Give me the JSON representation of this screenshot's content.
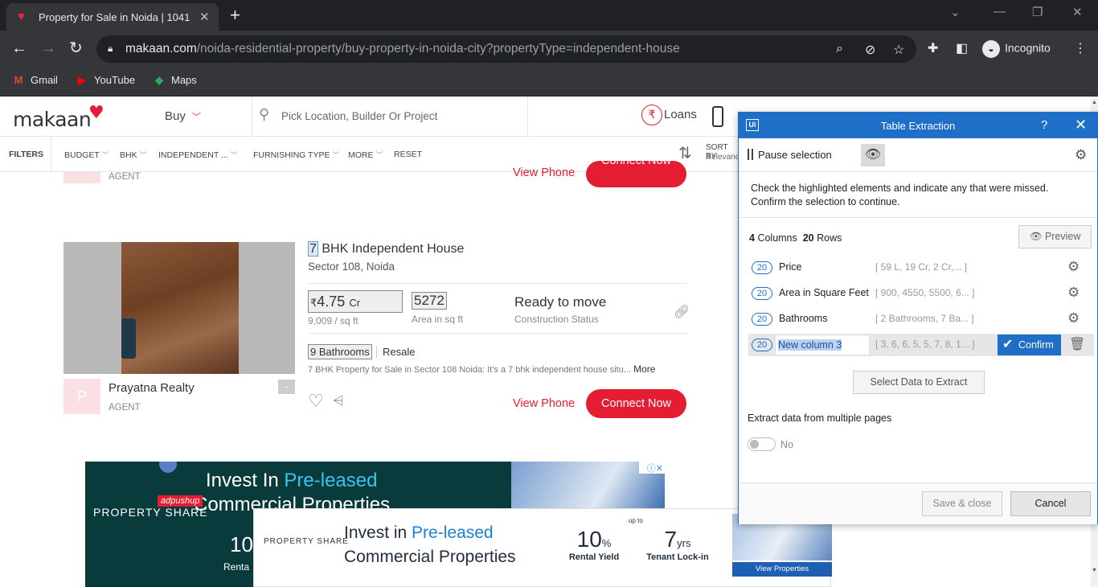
{
  "browser": {
    "tab_title": "Property for Sale in Noida | 1041",
    "url_host": "makaan.com",
    "url_path": "/noida-residential-property/buy-property-in-noida-city?propertyType=independent-house",
    "profile": "Incognito",
    "bookmarks": [
      "Gmail",
      "YouTube",
      "Maps"
    ]
  },
  "site": {
    "logo": "makaan",
    "buy": "Buy",
    "search_placeholder": "Pick Location, Builder Or Project",
    "loans": "Loans",
    "filters": [
      "FILTERS",
      "BUDGET",
      "BHK",
      "INDEPENDENT ...",
      "FURNISHING TYPE",
      "MORE",
      "RESET"
    ],
    "sort_label": "SORT BY",
    "sort_value": "Relevance"
  },
  "prev_listing": {
    "agent_role": "AGENT",
    "view_phone": "View Phone",
    "connect": "Connect Now"
  },
  "listing": {
    "title_num": "7",
    "title_rest": " BHK Independent House",
    "location": "Sector 108, Noida",
    "price_symbol": "₹",
    "price_value": "4.75",
    "price_unit": "Cr",
    "price_per_sqft": "9,009 / sq ft",
    "area": "5272",
    "area_label": "Area in sq ft",
    "status": "Ready to move",
    "status_label": "Construction Status",
    "bathrooms": "9 Bathrooms",
    "sale_type": "Resale",
    "description": "7 BHK Property for Sale in Sector 108 Noida: It's a 7 bhk independent house situ...",
    "more": "More",
    "agent_initial": "P",
    "agent_name": "Prayatna Realty",
    "agent_role": "AGENT",
    "view_phone": "View Phone",
    "connect": "Connect Now"
  },
  "ads": {
    "ad1_line1_a": "Invest In ",
    "ad1_line1_b": "Pre-leased",
    "ad1_line2": "Commercial Properties",
    "ad1_brand": "PROPERTY SHARE",
    "ad1_tag": "adpushup",
    "ad1_stat": "10",
    "ad1_stat_lbl": "Renta",
    "ad2_brand": "PROPERTY SHARE",
    "ad2_line1_a": "Invest in ",
    "ad2_line1_b": "Pre-leased",
    "ad2_line2": "Commercial Properties",
    "ad2_stat1": "10",
    "ad2_stat1_unit": "%",
    "ad2_stat1_lbl": "Rental Yield",
    "ad2_upto": "up to",
    "ad2_stat2": "7",
    "ad2_stat2_unit": "yrs",
    "ad2_stat2_lbl": "Tenant Lock-in",
    "ad2_cta": "View Properties"
  },
  "dialog": {
    "title": "Table Extraction",
    "pause": "Pause selection",
    "instructions": "Check the highlighted elements and indicate any that were missed. Confirm the selection to continue.",
    "columns_count": "4",
    "columns_label": "Columns",
    "rows_count": "20",
    "rows_label": "Rows",
    "preview": "Preview",
    "columns": [
      {
        "count": "20",
        "name": "Price",
        "sample": "[ 59 L,  19 Cr,  2 Cr,... ]"
      },
      {
        "count": "20",
        "name": "Area in Square Feet",
        "sample": "[ 900, 4550, 5500, 6... ]"
      },
      {
        "count": "20",
        "name": "Bathrooms",
        "sample": "[ 2 Bathrooms, 7 Ba... ]"
      },
      {
        "count": "20",
        "name": "New column 3",
        "sample": "[ 3, 6, 6, 5, 5, 7, 8, 1... ]"
      }
    ],
    "confirm": "Confirm",
    "select_data": "Select Data to Extract",
    "multi_pages": "Extract data from multiple pages",
    "toggle_value": "No",
    "save_close": "Save & close",
    "cancel": "Cancel"
  }
}
